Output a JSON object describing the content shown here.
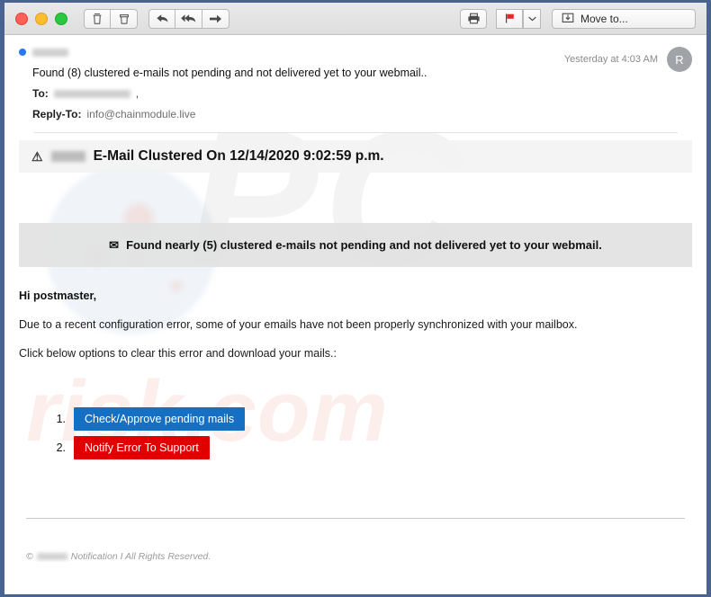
{
  "toolbar": {
    "traffic_lights": [
      "close",
      "minimize",
      "maximize"
    ],
    "buttons": [
      {
        "name": "delete",
        "icon": "trash-icon"
      },
      {
        "name": "junk",
        "icon": "junk-bin-icon"
      },
      {
        "name": "reply",
        "icon": "reply-arrow-icon"
      },
      {
        "name": "reply-all",
        "icon": "reply-all-arrow-icon"
      },
      {
        "name": "forward",
        "icon": "forward-arrow-icon"
      }
    ],
    "print_icon": "printer-icon",
    "flag_icon": "flag-icon",
    "flag_color": "#e8262a",
    "flag_dropdown_icon": "chevron-down-icon",
    "move_to_icon": "move-to-folder-icon",
    "move_to_label": "Move to..."
  },
  "message": {
    "unread": true,
    "sender_redacted": true,
    "subject": "Found (8) clustered e-mails not pending and not delivered yet to your webmail..",
    "timestamp": "Yesterday at 4:03 AM",
    "avatar_initial": "R",
    "to_label": "To:",
    "to_value_redacted": true,
    "to_trailing": ",",
    "reply_to_label": "Reply-To:",
    "reply_to_value": "info@chainmodule.live"
  },
  "email": {
    "watermarks": {
      "primary": "PC",
      "secondary": "risk.com"
    },
    "alert": {
      "warning_icon": "warning-triangle-icon",
      "brand_redacted": true,
      "text": "E-Mail Clustered On 12/14/2020 9:02:59 p.m."
    },
    "notice": {
      "envelope_icon": "envelope-icon",
      "text": "Found nearly (5) clustered e-mails not pending and not delivered yet to your webmail."
    },
    "greeting": "Hi postmaster,",
    "paragraphs": [
      "Due to a recent configuration error, some of your emails have not been properly synchronized with your mailbox.",
      "Click below options to clear this error and download your mails.:"
    ],
    "actions": [
      {
        "label": "Check/Approve pending mails",
        "color": "#1570c4"
      },
      {
        "label": "Notify Error To Support",
        "color": "#e00000"
      }
    ],
    "footer": {
      "copyright_symbol": "©",
      "brand_redacted": true,
      "text": "Notification I All Rights Reserved."
    }
  }
}
